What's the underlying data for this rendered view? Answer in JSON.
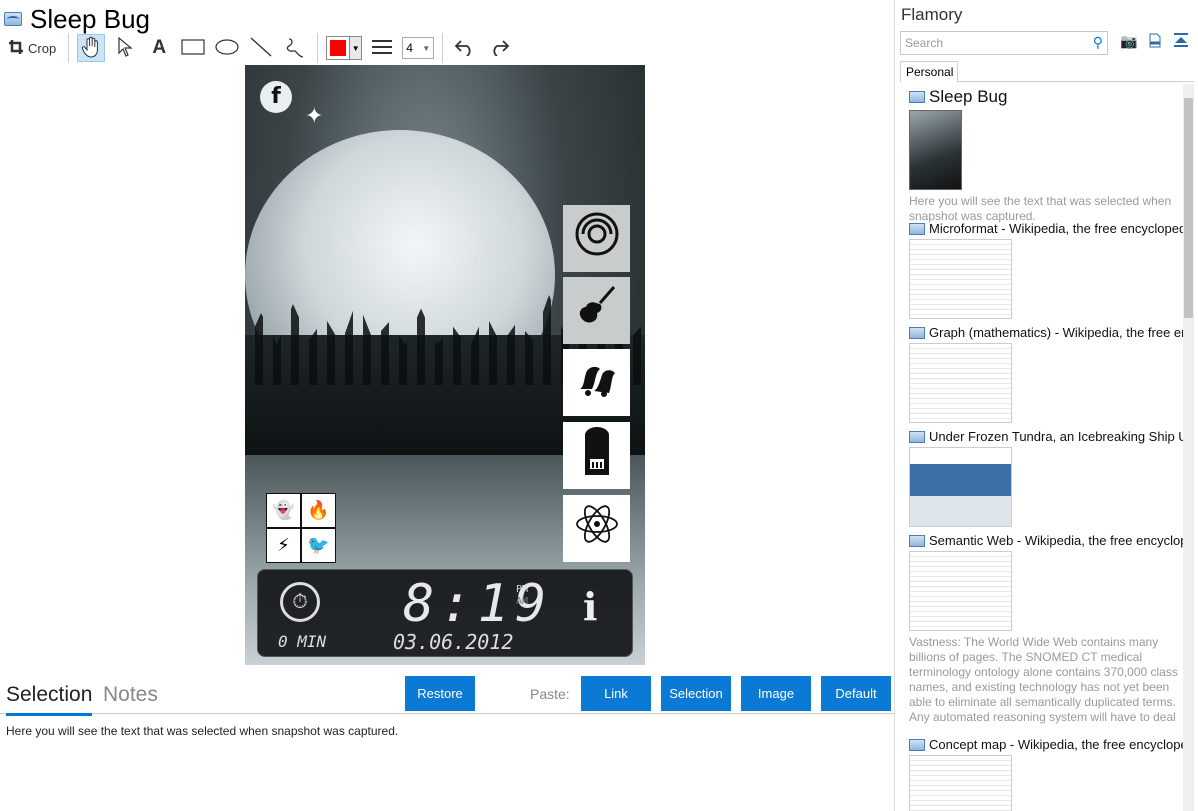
{
  "header": {
    "title": "Sleep Bug"
  },
  "toolbar": {
    "crop_label": "Crop",
    "stroke_width": "4",
    "color": "#ff0000"
  },
  "screenshot": {
    "fb_label": "f",
    "time": "8:19",
    "pm": "PM",
    "am": "AM",
    "minutes": "0 MIN",
    "date": "03.06.2012",
    "info": "i"
  },
  "bottom": {
    "tab_selection": "Selection",
    "tab_notes": "Notes",
    "restore": "Restore",
    "paste_label": "Paste:",
    "link": "Link",
    "selection": "Selection",
    "image": "Image",
    "default": "Default",
    "selected_text": "Here you will see the text that was selected when snapshot was captured."
  },
  "sidebar": {
    "brand": "Flamory",
    "search_placeholder": "Search",
    "tab": "Personal",
    "items": [
      {
        "title": "Sleep Bug",
        "caption": "Here you will see the text that was selected when snapshot was captured."
      },
      {
        "title": "Microformat - Wikipedia, the free encyclopedia"
      },
      {
        "title": "Graph (mathematics) - Wikipedia, the free encyc"
      },
      {
        "title": "Under Frozen Tundra, an Icebreaking Ship Unco"
      },
      {
        "title": "Semantic Web - Wikipedia, the free encycloped",
        "caption": "Vastness: The World Wide Web contains many billions of pages. The SNOMED CT medical terminology ontology alone contains 370,000 class names, and existing technology has not yet been able to eliminate all semantically duplicated terms. Any automated reasoning system will have to deal with truly huge inputs."
      },
      {
        "title": "Concept map - Wikipedia, the free encyclopedi"
      }
    ]
  }
}
